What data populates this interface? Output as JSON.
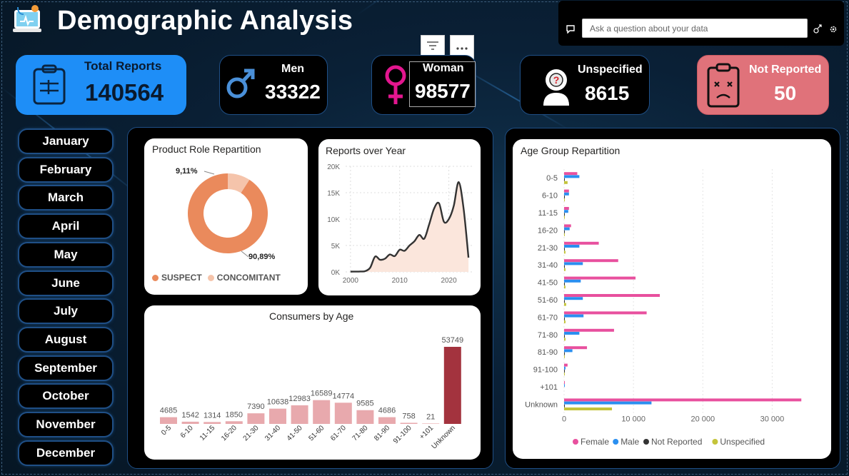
{
  "header": {
    "title": "Demographic Analysis"
  },
  "qa": {
    "placeholder": "Ask a question about your data"
  },
  "toolbar": {
    "filter_icon": "filter-icon",
    "more_icon": "more-options-icon"
  },
  "kpis": {
    "total": {
      "label": "Total Reports",
      "value": "140564",
      "color": "#1e8ef7"
    },
    "men": {
      "label": "Men",
      "value": "33322"
    },
    "woman": {
      "label": "Woman",
      "value": "98577"
    },
    "unspecified": {
      "label": "Unspecified",
      "value": "8615"
    },
    "not_reported": {
      "label": "Not Reported",
      "value": "50",
      "color": "#e0727a"
    }
  },
  "months": [
    "January",
    "February",
    "March",
    "April",
    "May",
    "June",
    "July",
    "August",
    "September",
    "October",
    "November",
    "December"
  ],
  "colors": {
    "suspect": "#ea8a5c",
    "concomitant": "#f5c4ab",
    "female": "#e8509e",
    "male": "#2a8ff0",
    "not_reported": "#333333",
    "unspecified": "#c4c43a",
    "consumer_bar": "#e8a9ad",
    "unknown_bar": "#a3333e",
    "line": "#333333",
    "area": "#fbe6dc"
  },
  "product_role": {
    "title": "Product Role Repartition",
    "legend": [
      "SUSPECT",
      "CONCOMITANT"
    ],
    "chart_data": {
      "type": "pie",
      "categories": [
        "SUSPECT",
        "CONCOMITANT"
      ],
      "values": [
        90.89,
        9.11
      ],
      "labels": [
        "90,89%",
        "9,11%"
      ]
    }
  },
  "reports_year": {
    "title": "Reports over Year",
    "y_ticks": [
      "20K",
      "15K",
      "10K",
      "5K",
      "0K"
    ],
    "x_ticks": [
      "2000",
      "2010",
      "2020"
    ],
    "chart_data": {
      "type": "area",
      "x": [
        2000,
        2001,
        2002,
        2003,
        2004,
        2005,
        2006,
        2007,
        2008,
        2009,
        2010,
        2011,
        2012,
        2013,
        2014,
        2015,
        2016,
        2017,
        2018,
        2019,
        2020,
        2021,
        2022,
        2023,
        2024
      ],
      "values": [
        50,
        60,
        80,
        150,
        800,
        2900,
        2300,
        2500,
        3300,
        3000,
        4200,
        4000,
        5000,
        5800,
        7000,
        6300,
        9000,
        12000,
        13000,
        9500,
        10000,
        12500,
        17000,
        12000,
        2700
      ],
      "ylim": [
        0,
        20000
      ],
      "xlim": [
        1999,
        2025
      ]
    }
  },
  "consumers_age": {
    "title": "Consumers by Age",
    "chart_data": {
      "type": "bar",
      "categories": [
        "0-5",
        "6-10",
        "11-15",
        "16-20",
        "21-30",
        "31-40",
        "41-50",
        "51-60",
        "61-70",
        "71-80",
        "81-90",
        "91-100",
        "+101",
        "Unknown"
      ],
      "values": [
        4685,
        1542,
        1314,
        1850,
        7390,
        10638,
        12983,
        16589,
        14774,
        9585,
        4686,
        758,
        21,
        53749
      ],
      "ylim": [
        0,
        56000
      ]
    }
  },
  "age_group": {
    "title": "Age Group Repartition",
    "x_ticks": [
      "0",
      "10 000",
      "20 000",
      "30 000"
    ],
    "legend": [
      "Female",
      "Male",
      "Not Reported",
      "Unspecified"
    ],
    "chart_data": {
      "type": "bar",
      "orientation": "horizontal",
      "categories": [
        "0-5",
        "6-10",
        "11-15",
        "16-20",
        "21-30",
        "31-40",
        "41-50",
        "51-60",
        "61-70",
        "71-80",
        "81-90",
        "91-100",
        "+101",
        "Unknown"
      ],
      "series": [
        {
          "name": "Female",
          "values": [
            1900,
            700,
            700,
            1000,
            5000,
            7800,
            10300,
            13800,
            11900,
            7200,
            3300,
            500,
            15,
            34200
          ]
        },
        {
          "name": "Male",
          "values": [
            2200,
            700,
            600,
            800,
            2200,
            2700,
            2400,
            2700,
            2800,
            2200,
            1200,
            200,
            6,
            12600
          ]
        },
        {
          "name": "Not Reported",
          "values": [
            10,
            5,
            5,
            5,
            5,
            5,
            5,
            5,
            5,
            5,
            5,
            1,
            0,
            5
          ]
        },
        {
          "name": "Unspecified",
          "values": [
            500,
            100,
            50,
            80,
            200,
            200,
            200,
            300,
            200,
            200,
            100,
            50,
            0,
            6900
          ]
        }
      ],
      "xlim": [
        0,
        35000
      ]
    }
  }
}
